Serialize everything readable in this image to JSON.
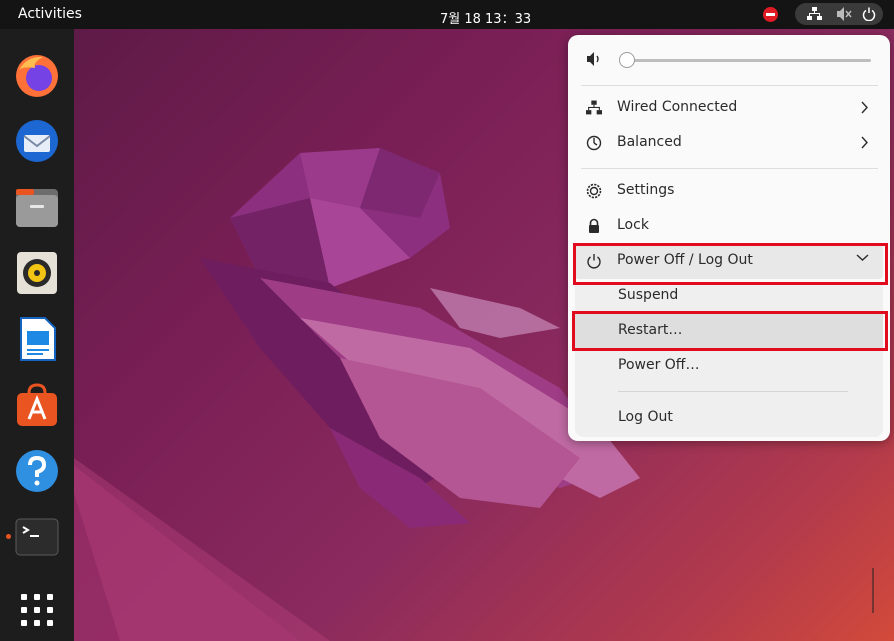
{
  "topbar": {
    "activities_label": "Activities",
    "clock": "7월 18  13：33",
    "status_icons": [
      "stop-icon",
      "network-wired-icon",
      "volume-muted-icon",
      "power-icon"
    ]
  },
  "dock": {
    "items": [
      {
        "name": "Firefox",
        "icon": "firefox-icon"
      },
      {
        "name": "Thunderbird",
        "icon": "thunderbird-icon"
      },
      {
        "name": "Files",
        "icon": "files-icon"
      },
      {
        "name": "Rhythmbox",
        "icon": "rhythmbox-icon"
      },
      {
        "name": "LibreOffice Writer",
        "icon": "writer-icon"
      },
      {
        "name": "Ubuntu Software",
        "icon": "software-icon"
      },
      {
        "name": "Help",
        "icon": "help-icon"
      },
      {
        "name": "Terminal",
        "icon": "terminal-icon",
        "running": true
      },
      {
        "name": "Show Applications",
        "icon": "app-grid-icon"
      }
    ]
  },
  "system_menu": {
    "volume": {
      "icon": "volume-icon",
      "level": 0.0
    },
    "network": {
      "label": "Wired Connected",
      "icon": "network-wired-icon"
    },
    "power_mode": {
      "label": "Balanced",
      "icon": "power-mode-icon"
    },
    "settings": {
      "label": "Settings",
      "icon": "settings-icon"
    },
    "lock": {
      "label": "Lock",
      "icon": "lock-icon"
    },
    "power": {
      "label": "Power Off / Log Out",
      "icon": "power-icon",
      "expanded": true,
      "items": [
        {
          "label": "Suspend"
        },
        {
          "label": "Restart…",
          "highlighted": true
        },
        {
          "label": "Power Off…"
        },
        {
          "label": "Log Out"
        }
      ]
    }
  },
  "colors": {
    "accent": "#e95420",
    "annotation": "#e00b1c",
    "topbar": "#141414",
    "dock": "#1d1d1d",
    "menu_bg": "#fafafa"
  }
}
